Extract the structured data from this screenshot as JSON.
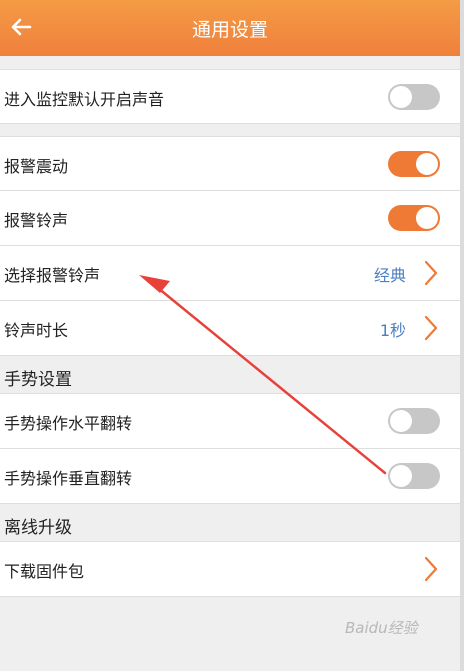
{
  "header": {
    "title": "通用设置"
  },
  "rows": {
    "monitor_sound": {
      "label": "进入监控默认开启声音",
      "on": false
    },
    "alarm_vibrate": {
      "label": "报警震动",
      "on": true
    },
    "alarm_ringtone": {
      "label": "报警铃声",
      "on": true
    },
    "choose_ringtone": {
      "label": "选择报警铃声",
      "value": "经典"
    },
    "ringtone_duration": {
      "label": "铃声时长",
      "value": "1秒"
    },
    "gesture_horizontal": {
      "label": "手势操作水平翻转",
      "on": false
    },
    "gesture_vertical": {
      "label": "手势操作垂直翻转",
      "on": false
    },
    "download_firmware": {
      "label": "下载固件包"
    }
  },
  "sections": {
    "gesture": "手势设置",
    "offline": "离线升级"
  },
  "watermark": "Baidu经验",
  "colors": {
    "accent": "#ef7a35",
    "link": "#4a7fc1",
    "annotation_arrow": "#e8413a"
  }
}
